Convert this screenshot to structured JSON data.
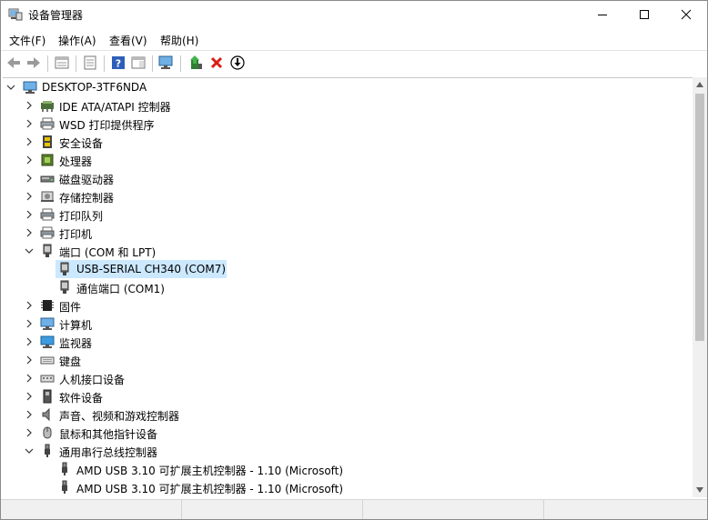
{
  "window": {
    "title": "设备管理器"
  },
  "menu": [
    "文件(F)",
    "操作(A)",
    "查看(V)",
    "帮助(H)"
  ],
  "toolbar": [
    "back-icon",
    "forward-icon",
    "properties-sheet-icon",
    "show-hide-console-tree-icon",
    "help-icon",
    "action-pane-icon",
    "monitor-icon",
    "update-driver-icon",
    "uninstall-icon",
    "disable-device-icon"
  ],
  "tree": {
    "root": "DESKTOP-3TF6NDA",
    "items": [
      {
        "label": "IDE ATA/ATAPI 控制器",
        "level": 1,
        "expanded": false,
        "icon": "ide-controller-icon"
      },
      {
        "label": "WSD 打印提供程序",
        "level": 1,
        "expanded": false,
        "icon": "wsd-printer-icon"
      },
      {
        "label": "安全设备",
        "level": 1,
        "expanded": false,
        "icon": "security-device-icon"
      },
      {
        "label": "处理器",
        "level": 1,
        "expanded": false,
        "icon": "processor-icon"
      },
      {
        "label": "磁盘驱动器",
        "level": 1,
        "expanded": false,
        "icon": "disk-drive-icon"
      },
      {
        "label": "存储控制器",
        "level": 1,
        "expanded": false,
        "icon": "storage-controller-icon"
      },
      {
        "label": "打印队列",
        "level": 1,
        "expanded": false,
        "icon": "print-queue-icon"
      },
      {
        "label": "打印机",
        "level": 1,
        "expanded": false,
        "icon": "printer-icon"
      },
      {
        "label": "端口 (COM 和 LPT)",
        "level": 1,
        "expanded": true,
        "icon": "port-icon"
      },
      {
        "label": "USB-SERIAL CH340 (COM7)",
        "level": 2,
        "selected": true,
        "icon": "port-icon"
      },
      {
        "label": "通信端口 (COM1)",
        "level": 2,
        "icon": "port-icon"
      },
      {
        "label": "固件",
        "level": 1,
        "expanded": false,
        "icon": "firmware-icon"
      },
      {
        "label": "计算机",
        "level": 1,
        "expanded": false,
        "icon": "computer-icon"
      },
      {
        "label": "监视器",
        "level": 1,
        "expanded": false,
        "icon": "monitor-icon"
      },
      {
        "label": "键盘",
        "level": 1,
        "expanded": false,
        "icon": "keyboard-icon"
      },
      {
        "label": "人机接口设备",
        "level": 1,
        "expanded": false,
        "icon": "hid-icon"
      },
      {
        "label": "软件设备",
        "level": 1,
        "expanded": false,
        "icon": "software-device-icon"
      },
      {
        "label": "声音、视频和游戏控制器",
        "level": 1,
        "expanded": false,
        "icon": "sound-icon"
      },
      {
        "label": "鼠标和其他指针设备",
        "level": 1,
        "expanded": false,
        "icon": "mouse-icon"
      },
      {
        "label": "通用串行总线控制器",
        "level": 1,
        "expanded": true,
        "icon": "usb-icon"
      },
      {
        "label": "AMD USB 3.10 可扩展主机控制器 - 1.10 (Microsoft)",
        "level": 2,
        "icon": "usb-icon"
      },
      {
        "label": "AMD USB 3.10 可扩展主机控制器 - 1.10 (Microsoft)",
        "level": 2,
        "icon": "usb-icon"
      }
    ]
  },
  "colors": {
    "selection": "#cce8ff",
    "accent": "#1e6fb4"
  }
}
